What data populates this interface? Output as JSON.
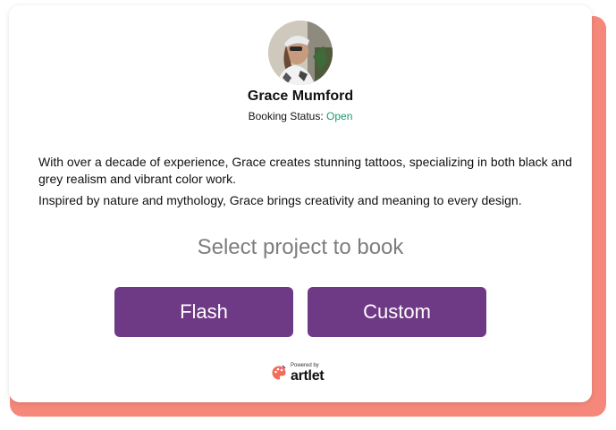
{
  "profile": {
    "name": "Grace Mumford",
    "status_label": "Booking Status:",
    "status_value": "Open"
  },
  "bio": {
    "paragraph_1": "With over a decade of experience, Grace creates stunning tattoos, specializing in both black and grey realism and vibrant color work.",
    "paragraph_2": "Inspired by nature and mythology, Grace brings creativity and meaning to every design."
  },
  "booking": {
    "title": "Select project to book",
    "flash_label": "Flash",
    "custom_label": "Custom"
  },
  "footer": {
    "powered_by": "Powered by",
    "brand": "artlet",
    "icon": "palette-icon"
  },
  "colors": {
    "accent_button": "#6f3a85",
    "open_status": "#1a9a6a",
    "card_shadow": "#f5887a",
    "brand_icon": "#f26b5b"
  }
}
